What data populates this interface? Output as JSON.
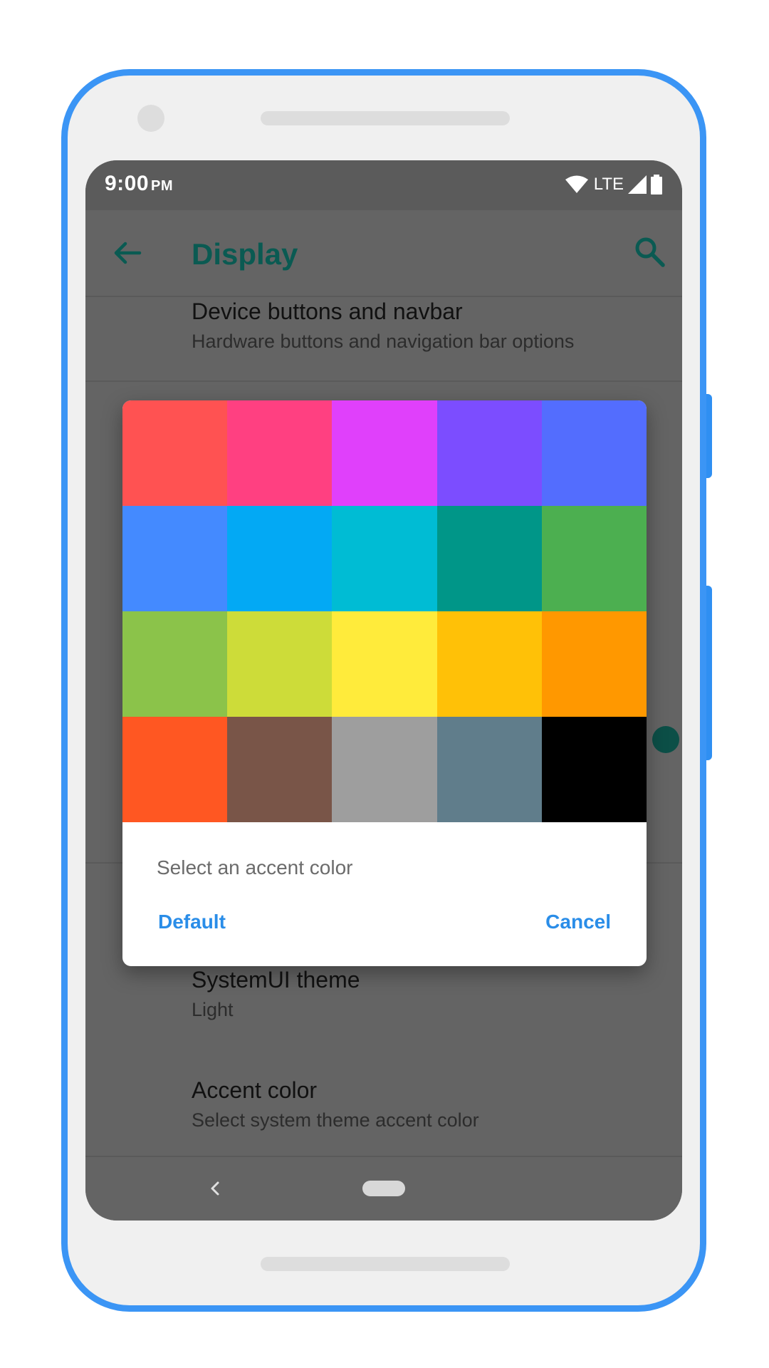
{
  "status_bar": {
    "time": "9:00",
    "ampm": "PM",
    "network": "LTE",
    "icons": [
      "wifi-icon",
      "signal-icon",
      "battery-icon"
    ]
  },
  "app_bar": {
    "title": "Display",
    "back_icon": "arrow-back-icon",
    "search_icon": "search-icon",
    "accent_color": "#0a5a52"
  },
  "settings": {
    "device_buttons": {
      "title": "Device buttons and navbar",
      "subtitle": "Hardware buttons and navigation bar options"
    },
    "systemui_theme": {
      "title": "SystemUI theme",
      "subtitle": "Light"
    },
    "accent_color": {
      "title": "Accent color",
      "subtitle": "Select system theme accent color"
    }
  },
  "dialog": {
    "message": "Select an accent color",
    "default_label": "Default",
    "cancel_label": "Cancel",
    "button_color": "#2a8de8",
    "swatches": [
      "#ff5252",
      "#ff4081",
      "#e040fb",
      "#7c4dff",
      "#536dfe",
      "#448aff",
      "#03a9f4",
      "#00bcd4",
      "#009688",
      "#4caf50",
      "#8bc34a",
      "#cddc39",
      "#ffeb3b",
      "#ffc107",
      "#ff9800",
      "#ff5722",
      "#795548",
      "#9e9e9e",
      "#607d8b",
      "#000000"
    ]
  },
  "nav_bar": {
    "back_icon": "nav-back-icon",
    "home_icon": "nav-home-pill"
  },
  "device_frame": {
    "frame_color": "#3b95f5"
  }
}
